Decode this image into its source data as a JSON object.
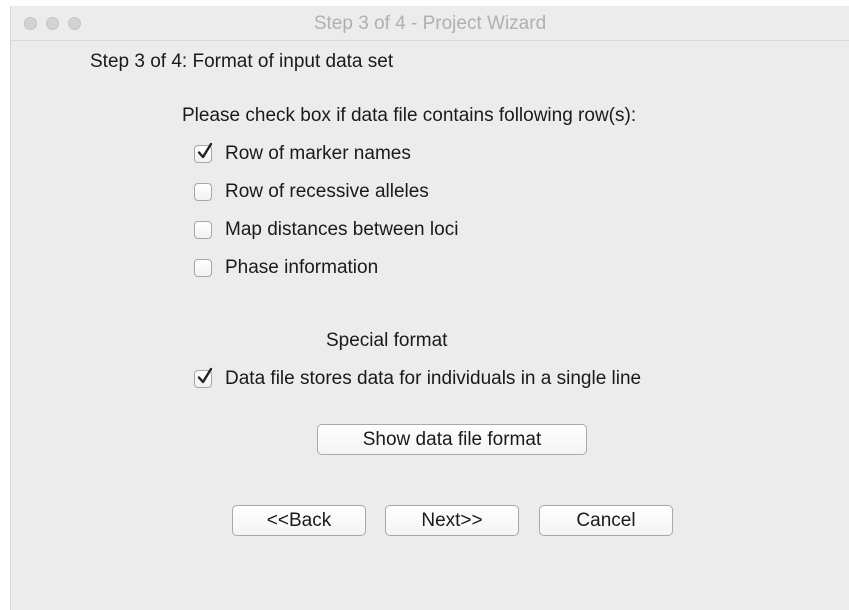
{
  "window": {
    "title": "Step 3 of 4 - Project Wizard"
  },
  "step_heading": "Step 3 of 4: Format of input data set",
  "instruction": "Please check box if data file contains following row(s):",
  "rows": [
    {
      "label": "Row of marker names",
      "checked": true
    },
    {
      "label": "Row of recessive alleles",
      "checked": false
    },
    {
      "label": "Map distances between loci",
      "checked": false
    },
    {
      "label": "Phase information",
      "checked": false
    }
  ],
  "special_format": {
    "label": "Special format",
    "option_label": "Data file stores data for individuals in a single line",
    "option_checked": true,
    "show_format_button": "Show data file format"
  },
  "buttons": {
    "back": "<<Back",
    "next": "Next>>",
    "cancel": "Cancel"
  },
  "colors": {
    "window_bg": "#ececec",
    "title_text": "#b0b0b0"
  },
  "icons": {
    "check": "checkmark-icon",
    "window_controls": "traffic-light-icons"
  }
}
